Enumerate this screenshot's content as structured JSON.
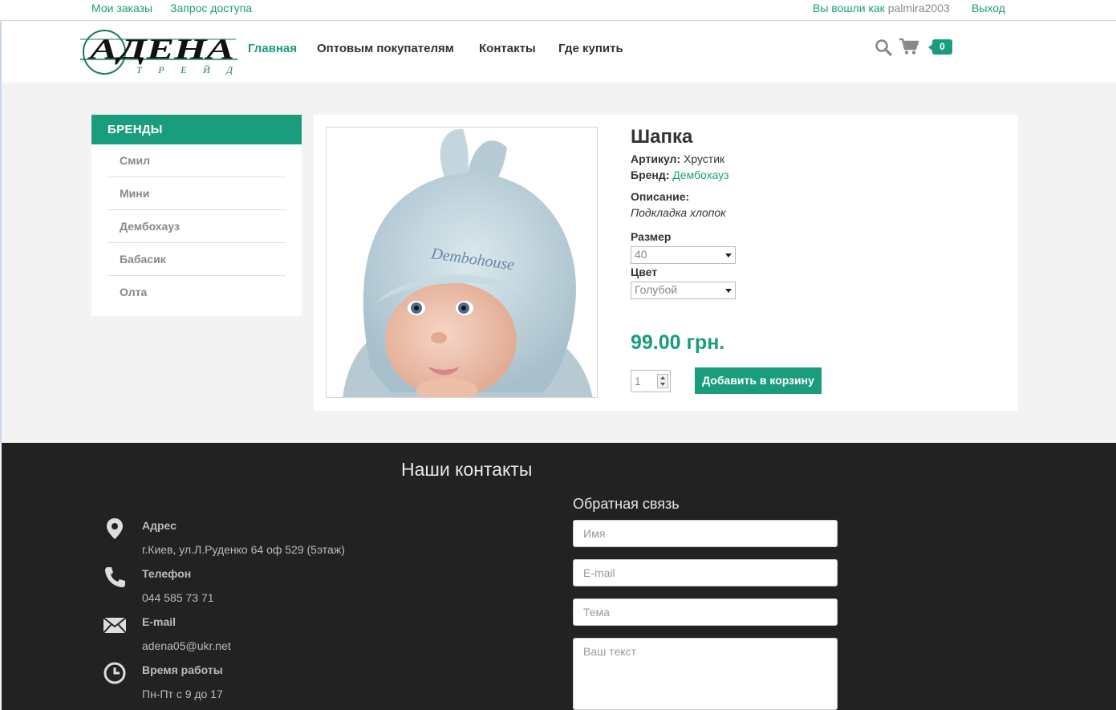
{
  "topbar": {
    "my_orders": "Мои заказы",
    "access_request": "Запрос доступа",
    "logged_in_prefix": "Вы вошли как",
    "username": "palmira2003",
    "logout": "Выход"
  },
  "logo": {
    "main": "АДЕНА",
    "sub": "Т Р Е Й Д"
  },
  "nav": [
    {
      "label": "Главная",
      "active": true
    },
    {
      "label": "Оптовым покупателям",
      "active": false
    },
    {
      "label": "Контакты",
      "active": false
    },
    {
      "label": "Где купить",
      "active": false
    }
  ],
  "cart": {
    "count": "0"
  },
  "sidebar": {
    "title": "БРЕНДЫ",
    "items": [
      "Смил",
      "Мини",
      "Дембохауз",
      "Бабасик",
      "Олта"
    ]
  },
  "product": {
    "title": "Шапка",
    "article_label": "Артикул:",
    "article_value": "Хрустик",
    "brand_label": "Бренд:",
    "brand_value": "Дембохауз",
    "description_label": "Описание:",
    "description": "Подкладка хлопок",
    "size_label": "Размер",
    "size_value": "40",
    "color_label": "Цвет",
    "color_value": "Голубой",
    "price": "99.00 грн.",
    "quantity": "1",
    "add_to_cart": "Добавить в корзину",
    "photo_brand_text": "Dembohouse"
  },
  "footer": {
    "title": "Наши контакты",
    "address_label": "Адрес",
    "address": "г.Киев, ул.Л.Руденко 64 оф 529 (5этаж)",
    "phone_label": "Телефон",
    "phone": "044 585 73 71",
    "email_label": "E-mail",
    "email": "adena05@ukr.net",
    "hours_label": "Время работы",
    "hours": "Пн-Пт с 9 до 17",
    "feedback_title": "Обратная связь",
    "name_placeholder": "Имя",
    "email_placeholder": "E-mail",
    "subject_placeholder": "Тема",
    "message_placeholder": "Ваш текст"
  },
  "colors": {
    "accent": "#1a9d7d",
    "footer_bg": "#222222",
    "page_bg": "#f3f3f3"
  }
}
